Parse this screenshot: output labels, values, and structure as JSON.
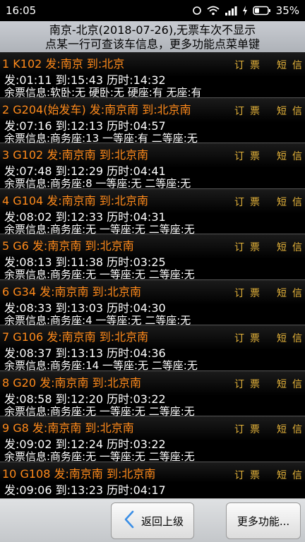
{
  "status_bar": {
    "time": "16:05",
    "battery": "35%",
    "icons": [
      "signal-ring-icon",
      "wifi-icon",
      "cell-signal-icon",
      "charging-icon",
      "battery-icon"
    ]
  },
  "header": {
    "line1": "南京-北京(2018-07-26),无票车次不显示",
    "line2": "点某一行可查该车信息，更多功能点菜单键"
  },
  "row_actions": {
    "book": "订票",
    "sms": "短信"
  },
  "trains": [
    {
      "title": "1 K102 发:南京 到:北京",
      "times": "发:01:11 到:15:43 历时:14:32",
      "seats": "余票信息:软卧:无 硬卧:无 硬座:有 无座:有"
    },
    {
      "title": "2 G204(始发车) 发:南京南 到:北京南",
      "times": "发:07:16 到:12:13 历时:04:57",
      "seats": "余票信息:商务座:13 一等座:有 二等座:无"
    },
    {
      "title": "3 G102 发:南京南 到:北京南",
      "times": "发:07:48 到:12:29 历时:04:41",
      "seats": "余票信息:商务座:8 一等座:无 二等座:无"
    },
    {
      "title": "4 G104 发:南京南 到:北京南",
      "times": "发:08:02 到:12:33 历时:04:31",
      "seats": "余票信息:商务座:无 一等座:无 二等座:无"
    },
    {
      "title": "5 G6 发:南京南 到:北京南",
      "times": "发:08:13 到:11:38 历时:03:25",
      "seats": "余票信息:商务座:无 一等座:无 二等座:无"
    },
    {
      "title": "6 G34 发:南京南 到:北京南",
      "times": "发:08:33 到:13:03 历时:04:30",
      "seats": "余票信息:商务座:4 一等座:无 二等座:无"
    },
    {
      "title": "7 G106 发:南京南 到:北京南",
      "times": "发:08:37 到:13:13 历时:04:36",
      "seats": "余票信息:商务座:14 一等座:无 二等座:无"
    },
    {
      "title": "8 G20 发:南京南 到:北京南",
      "times": "发:08:58 到:12:20 历时:03:22",
      "seats": "余票信息:商务座:无 一等座:无 二等座:无"
    },
    {
      "title": "9 G8 发:南京南 到:北京南",
      "times": "发:09:02 到:12:24 历时:03:22",
      "seats": "余票信息:商务座:无 一等座:无 二等座:无"
    },
    {
      "title": "10 G108 发:南京南 到:北京南",
      "times": "发:09:06 到:13:23 历时:04:17"
    }
  ],
  "bottom_bar": {
    "back_label": "返回上级",
    "back_icon": "chevron-left-icon",
    "more_label": "更多功能..."
  },
  "colors": {
    "title": "#ff8a1a",
    "action": "#e6b43a",
    "back_icon": "#3a8ee6"
  }
}
